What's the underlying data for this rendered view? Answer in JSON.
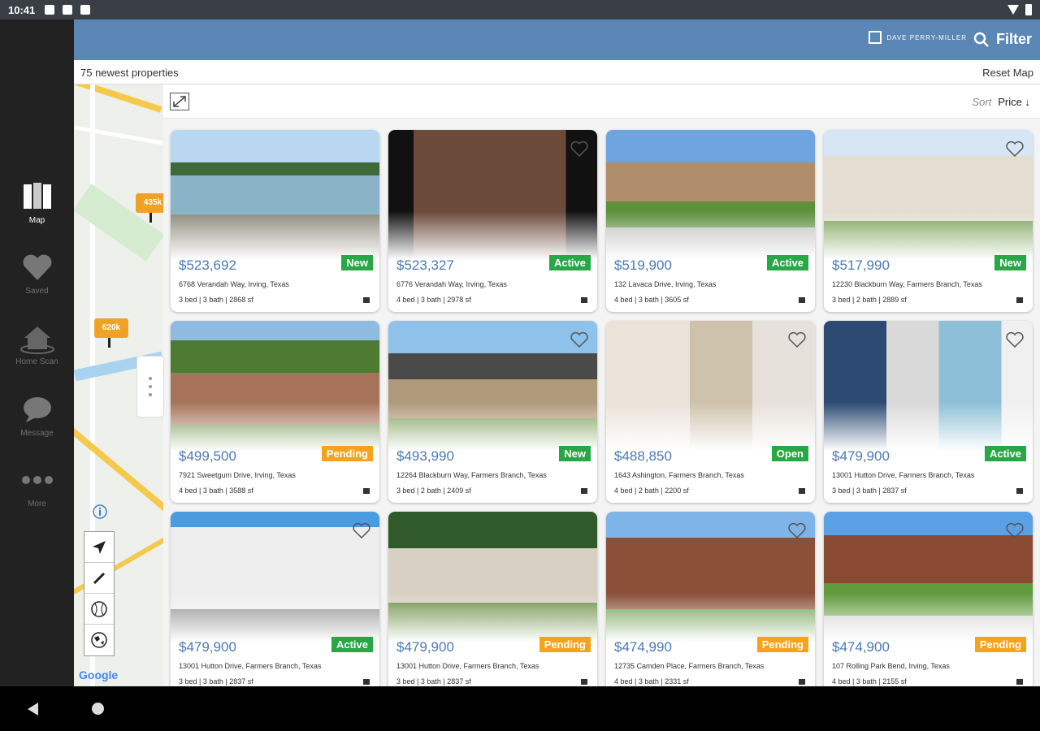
{
  "status": {
    "time": "10:41"
  },
  "rail": [
    {
      "label": "Map",
      "icon": "map-icon",
      "active": true
    },
    {
      "label": "Saved",
      "icon": "heart-icon",
      "active": false
    },
    {
      "label": "Home Scan",
      "icon": "home-scan-icon",
      "active": false
    },
    {
      "label": "Message",
      "icon": "message-icon",
      "active": false
    },
    {
      "label": "More",
      "icon": "more-icon",
      "active": false
    }
  ],
  "header": {
    "brand": "DAVE PERRY-MILLER",
    "filter_label": "Filter"
  },
  "info": {
    "count_text": "75 newest properties",
    "reset_label": "Reset Map"
  },
  "map": {
    "pins": [
      "435k",
      "620k"
    ],
    "google": "Google"
  },
  "sort": {
    "label": "Sort",
    "value": "Price ↓"
  },
  "listings": [
    {
      "price": "$523,692",
      "status": "New",
      "address": "6768 Verandah Way, Irving, Texas",
      "specs": "3 bed | 3 bath | 2868 sf"
    },
    {
      "price": "$523,327",
      "status": "Active",
      "address": "6776 Verandah Way, Irving, Texas",
      "specs": "4 bed | 3 bath | 2978 sf"
    },
    {
      "price": "$519,900",
      "status": "Active",
      "address": "132 Lavaca Drive, Irving, Texas",
      "specs": "4 bed | 3 bath | 3605 sf"
    },
    {
      "price": "$517,990",
      "status": "New",
      "address": "12230 Blackburn Way, Farmers Branch, Texas",
      "specs": "3 bed | 2 bath | 2889 sf"
    },
    {
      "price": "$499,500",
      "status": "Pending",
      "address": "7921 Sweetgum Drive, Irving, Texas",
      "specs": "4 bed | 3 bath | 3588 sf"
    },
    {
      "price": "$493,990",
      "status": "New",
      "address": "12264 Blackburn Way, Farmers Branch, Texas",
      "specs": "3 bed | 2 bath | 2409 sf"
    },
    {
      "price": "$488,850",
      "status": "Open",
      "address": "1643 Ashington, Farmers Branch, Texas",
      "specs": "4 bed | 2 bath | 2200 sf"
    },
    {
      "price": "$479,900",
      "status": "Active",
      "address": "13001 Hutton Drive, Farmers Branch, Texas",
      "specs": "3 bed | 3 bath | 2837 sf"
    },
    {
      "price": "$479,900",
      "status": "Active",
      "address": "13001 Hutton Drive, Farmers Branch, Texas",
      "specs": "3 bed | 3 bath | 2837 sf"
    },
    {
      "price": "$479,900",
      "status": "Pending",
      "address": "13001 Hutton Drive, Farmers Branch, Texas",
      "specs": "3 bed | 3 bath | 2837 sf"
    },
    {
      "price": "$474,990",
      "status": "Pending",
      "address": "12735 Camden Place, Farmers Branch, Texas",
      "specs": "4 bed | 3 bath | 2331 sf"
    },
    {
      "price": "$474,900",
      "status": "Pending",
      "address": "107 Rolling Park Bend, Irving, Texas",
      "specs": "4 bed | 3 bath | 2155 sf"
    }
  ]
}
